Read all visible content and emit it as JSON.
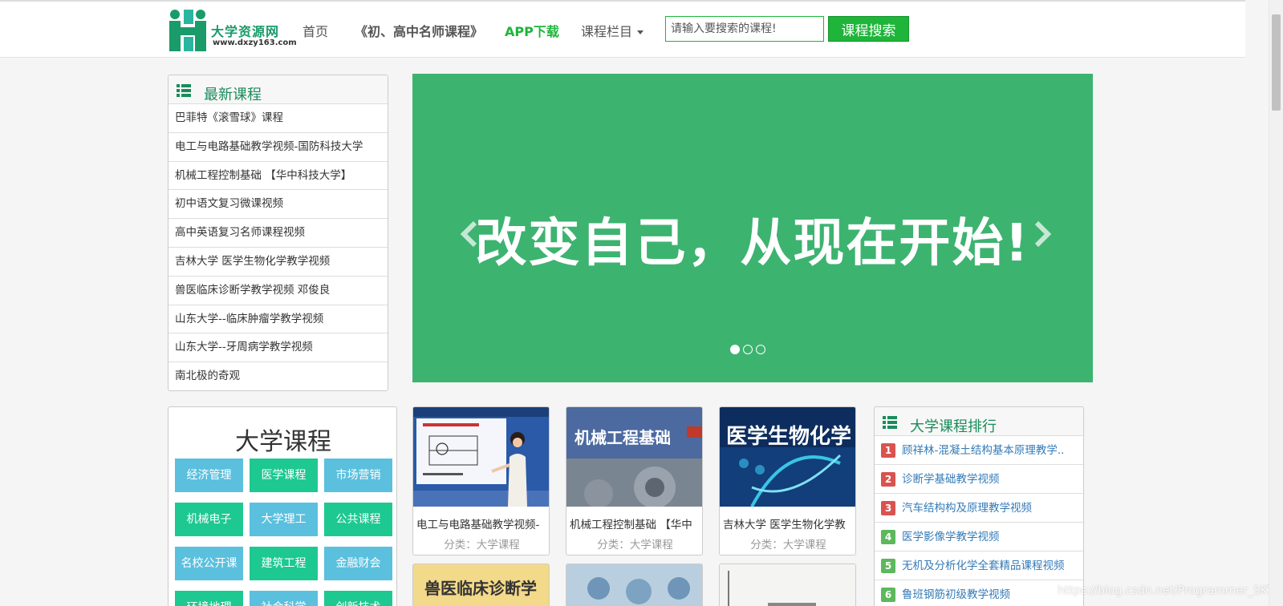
{
  "colors": {
    "brand_green": "#1eb53a",
    "banner_green": "#3db370",
    "link_blue": "#337ab7",
    "rank_red": "#d9534f",
    "rank_green": "#5cb85c"
  },
  "header": {
    "logo_name": "大学资源网",
    "logo_url": "www.dxzy163.com",
    "nav": {
      "home": "首页",
      "courses": "《初、高中名师课程》",
      "app": "APP下载",
      "columns": "课程栏目"
    },
    "search_placeholder": "请输入要搜索的课程!",
    "search_button": "课程搜索"
  },
  "latest": {
    "title": "最新课程",
    "items": [
      "巴菲特《滚雪球》课程",
      "电工与电路基础教学视频-国防科技大学",
      "机械工程控制基础 【华中科技大学】",
      "初中语文复习微课视频",
      "高中英语复习名师课程视频",
      "吉林大学 医学生物化学教学视频",
      "兽医临床诊断学教学视频 邓俊良",
      "山东大学--临床肿瘤学教学视频",
      "山东大学--牙周病学教学视频",
      "南北极的奇观"
    ]
  },
  "banner": {
    "slogan": "改变自己，从现在开始!",
    "slides": 3,
    "active_slide": 1
  },
  "university": {
    "title": "大学课程",
    "categories": [
      "经济管理",
      "医学课程",
      "市场营销",
      "机械电子",
      "大学理工",
      "公共课程",
      "名校公开课",
      "建筑工程",
      "金融财会",
      "环境地理",
      "社会科学",
      "创新技术"
    ]
  },
  "cards": [
    {
      "title": "电工与电路基础教学视频-",
      "category": "分类：大学课程",
      "img_text": ""
    },
    {
      "title": "机械工程控制基础 【华中",
      "category": "分类：大学课程",
      "img_text": "机械工程基础"
    },
    {
      "title": "吉林大学 医学生物化学教",
      "category": "分类：大学课程",
      "img_text": "医学生物化学"
    }
  ],
  "cards_row2": {
    "img_text_1": "兽医临床诊断学"
  },
  "ranking": {
    "title": "大学课程排行",
    "items": [
      {
        "num": "1",
        "text": "顾祥林-混凝土结构基本原理教学.."
      },
      {
        "num": "2",
        "text": "诊断学基础教学视频"
      },
      {
        "num": "3",
        "text": "汽车结构构及原理教学视频"
      },
      {
        "num": "4",
        "text": "医学影像学教学视频"
      },
      {
        "num": "5",
        "text": "无机及分析化学全套精品课程视频"
      },
      {
        "num": "6",
        "text": "鲁班钢筋初级教学视频"
      }
    ]
  },
  "watermark": "https://blog.csdn.net/Programmer_SKT"
}
